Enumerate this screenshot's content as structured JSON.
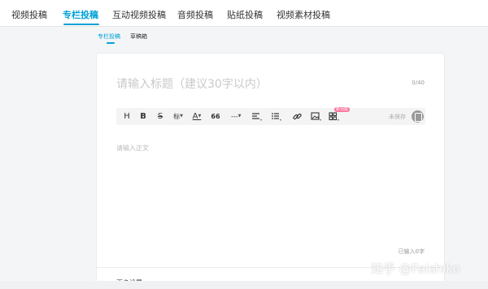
{
  "nav": {
    "tabs": [
      "视频投稿",
      "专栏投稿",
      "互动视频投稿",
      "音频投稿",
      "贴纸投稿",
      "视频素材投稿"
    ],
    "active_index": 1
  },
  "subtabs": [
    "专栏投稿",
    "草稿箱"
  ],
  "editor": {
    "title_placeholder": "请输入标题（建议30字以内）",
    "title_counter": "0/40",
    "toolbar": {
      "heading": "H",
      "bold": "B",
      "strike": "S",
      "style_label": "标",
      "font_color_label": "A",
      "quote_label": "66",
      "divider_label": "---",
      "image_badge": "新功能",
      "save_status": "未保存"
    },
    "body_placeholder": "请输入正文",
    "char_count": "已输入0字",
    "more_settings": "更多设置"
  },
  "watermark": "知乎 @Feishiko",
  "colors": {
    "accent": "#00a1d6",
    "badge": "#fb7299"
  }
}
